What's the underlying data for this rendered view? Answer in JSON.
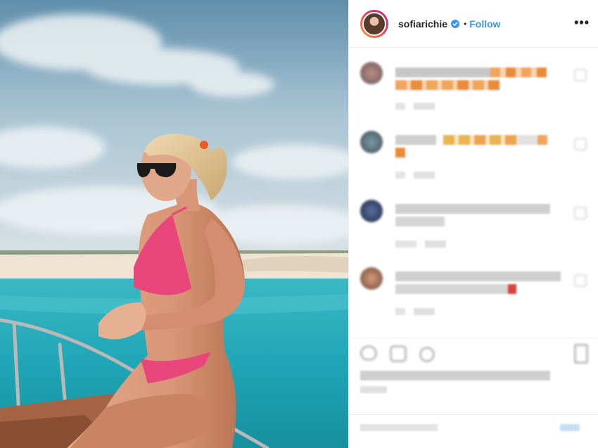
{
  "header": {
    "username": "sofiarichie",
    "follow_label": "Follow",
    "separator": "•",
    "more_label": "•••"
  },
  "colors": {
    "follow": "#3897f0",
    "verified": "#3897f0",
    "text": "#262626",
    "emoji_orange": "#f2a24a",
    "emoji_red": "#d9443a"
  },
  "icons": {
    "verified": "verified-badge-icon",
    "more": "more-options-icon",
    "like": "heart-icon",
    "comment": "comment-icon",
    "share": "share-icon",
    "save": "bookmark-icon"
  }
}
